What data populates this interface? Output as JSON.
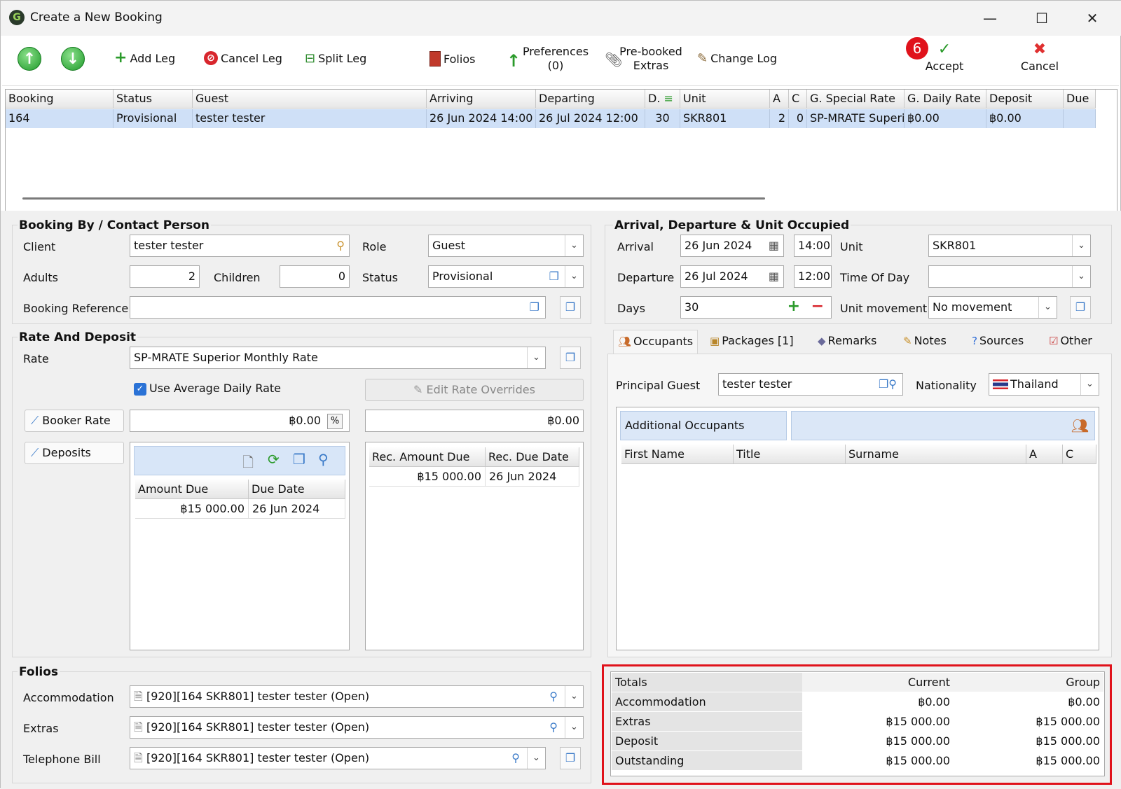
{
  "window": {
    "title": "Create a New Booking",
    "minimize": "—",
    "maximize": "☐",
    "close": "✕"
  },
  "toolbar": {
    "add_leg": "Add Leg",
    "cancel_leg": "Cancel Leg",
    "split_leg": "Split Leg",
    "folios": "Folios",
    "preferences": "Preferences",
    "preferences_count": "(0)",
    "prebooked": "Pre-booked",
    "prebooked2": "Extras",
    "change_log": "Change Log",
    "step_badge": "6",
    "accept": "Accept",
    "cancel": "Cancel"
  },
  "grid": {
    "headers": [
      "Booking",
      "Status",
      "Guest",
      "Arriving",
      "Departing",
      "D.",
      "Unit",
      "A",
      "C",
      "G. Special Rate",
      "G. Daily Rate",
      "Deposit",
      "Due"
    ],
    "row": [
      "164",
      "Provisional",
      "tester tester",
      "26 Jun 2024 14:00",
      "26 Jul 2024 12:00",
      "30",
      "SKR801",
      "2",
      "0",
      "SP-MRATE Superi",
      "฿0.00",
      "฿0.00",
      ""
    ]
  },
  "booking_by": {
    "title": "Booking By / Contact Person",
    "client_label": "Client",
    "client": "tester tester",
    "role_label": "Role",
    "role": "Guest",
    "adults_label": "Adults",
    "adults": "2",
    "children_label": "Children",
    "children": "0",
    "status_label": "Status",
    "status": "Provisional",
    "ref_label": "Booking Reference",
    "ref": ""
  },
  "arrival": {
    "title": "Arrival, Departure & Unit Occupied",
    "arrival_label": "Arrival",
    "arrival_date": "26 Jun 2024",
    "arrival_time": "14:00",
    "unit_label": "Unit",
    "unit": "SKR801",
    "departure_label": "Departure",
    "departure_date": "26 Jul 2024",
    "departure_time": "12:00",
    "tod_label": "Time Of Day",
    "tod": "",
    "days_label": "Days",
    "days": "30",
    "movement_label": "Unit movement",
    "movement": "No movement"
  },
  "rate": {
    "title": "Rate And Deposit",
    "rate_label": "Rate",
    "rate": "SP-MRATE Superior Monthly Rate",
    "use_avg": "Use Average Daily Rate",
    "edit_overrides": "Edit Rate Overrides",
    "booker_rate": "Booker Rate",
    "booker_value": "฿0.00",
    "pct": "%",
    "right_value": "฿0.00",
    "deposits": "Deposits",
    "dep_headers": [
      "Amount Due",
      "Due Date"
    ],
    "dep_row": [
      "฿15 000.00",
      "26 Jun 2024"
    ],
    "rec_headers": [
      "Rec. Amount Due",
      "Rec. Due Date"
    ],
    "rec_row": [
      "฿15 000.00",
      "26 Jun 2024"
    ]
  },
  "tabs": [
    "Occupants",
    "Packages [1]",
    "Remarks",
    "Notes",
    "Sources",
    "Other"
  ],
  "occupants": {
    "principal_label": "Principal Guest",
    "principal": "tester tester",
    "nationality_label": "Nationality",
    "nationality": "Thailand",
    "additional": "Additional Occupants",
    "headers": [
      "First Name",
      "Title",
      "Surname",
      "A",
      "C"
    ]
  },
  "folios": {
    "title": "Folios",
    "accommodation_label": "Accommodation",
    "accommodation": "[920][164 SKR801] tester tester (Open)",
    "extras_label": "Extras",
    "extras": "[920][164 SKR801] tester tester (Open)",
    "telephone_label": "Telephone Bill",
    "telephone": "[920][164 SKR801] tester tester (Open)"
  },
  "totals": {
    "headers": [
      "Totals",
      "Current",
      "Group"
    ],
    "rows": [
      [
        "Accommodation",
        "฿0.00",
        "฿0.00"
      ],
      [
        "Extras",
        "฿15 000.00",
        "฿15 000.00"
      ],
      [
        "Deposit",
        "฿15 000.00",
        "฿15 000.00"
      ],
      [
        "Outstanding",
        "฿15 000.00",
        "฿15 000.00"
      ]
    ]
  },
  "colors": {
    "highlight": "#e0121b",
    "selection": "#cfe0f7"
  }
}
